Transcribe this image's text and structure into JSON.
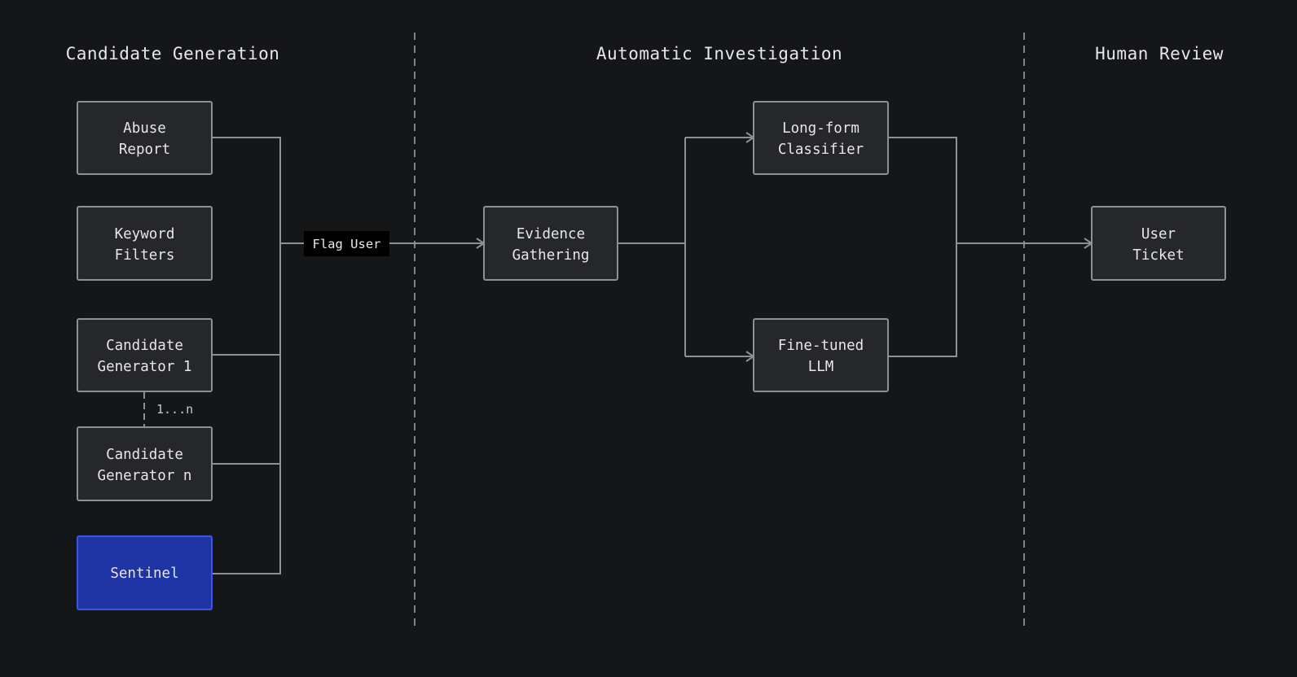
{
  "sections": {
    "candidate_generation": "Candidate Generation",
    "automatic_investigation": "Automatic Investigation",
    "human_review": "Human Review"
  },
  "nodes": {
    "abuse_report": [
      "Abuse",
      "Report"
    ],
    "keyword_filters": [
      "Keyword",
      "Filters"
    ],
    "candidate_generator_1": [
      "Candidate",
      "Generator 1"
    ],
    "candidate_generator_n": [
      "Candidate",
      "Generator n"
    ],
    "sentinel": [
      "Sentinel"
    ],
    "evidence_gathering": [
      "Evidence",
      "Gathering"
    ],
    "long_form_classifier": [
      "Long-form",
      "Classifier"
    ],
    "fine_tuned_llm": [
      "Fine-tuned",
      "LLM"
    ],
    "user_ticket": [
      "User",
      "Ticket"
    ]
  },
  "edge_labels": {
    "flag_user": "Flag User",
    "generator_range": "1...n"
  },
  "colors": {
    "background": "#151618",
    "node_fill": "#26272b",
    "node_border": "#8d9099",
    "highlight_fill": "#1f34a5",
    "highlight_border": "#3d56e0",
    "text": "#e6e7ea"
  }
}
